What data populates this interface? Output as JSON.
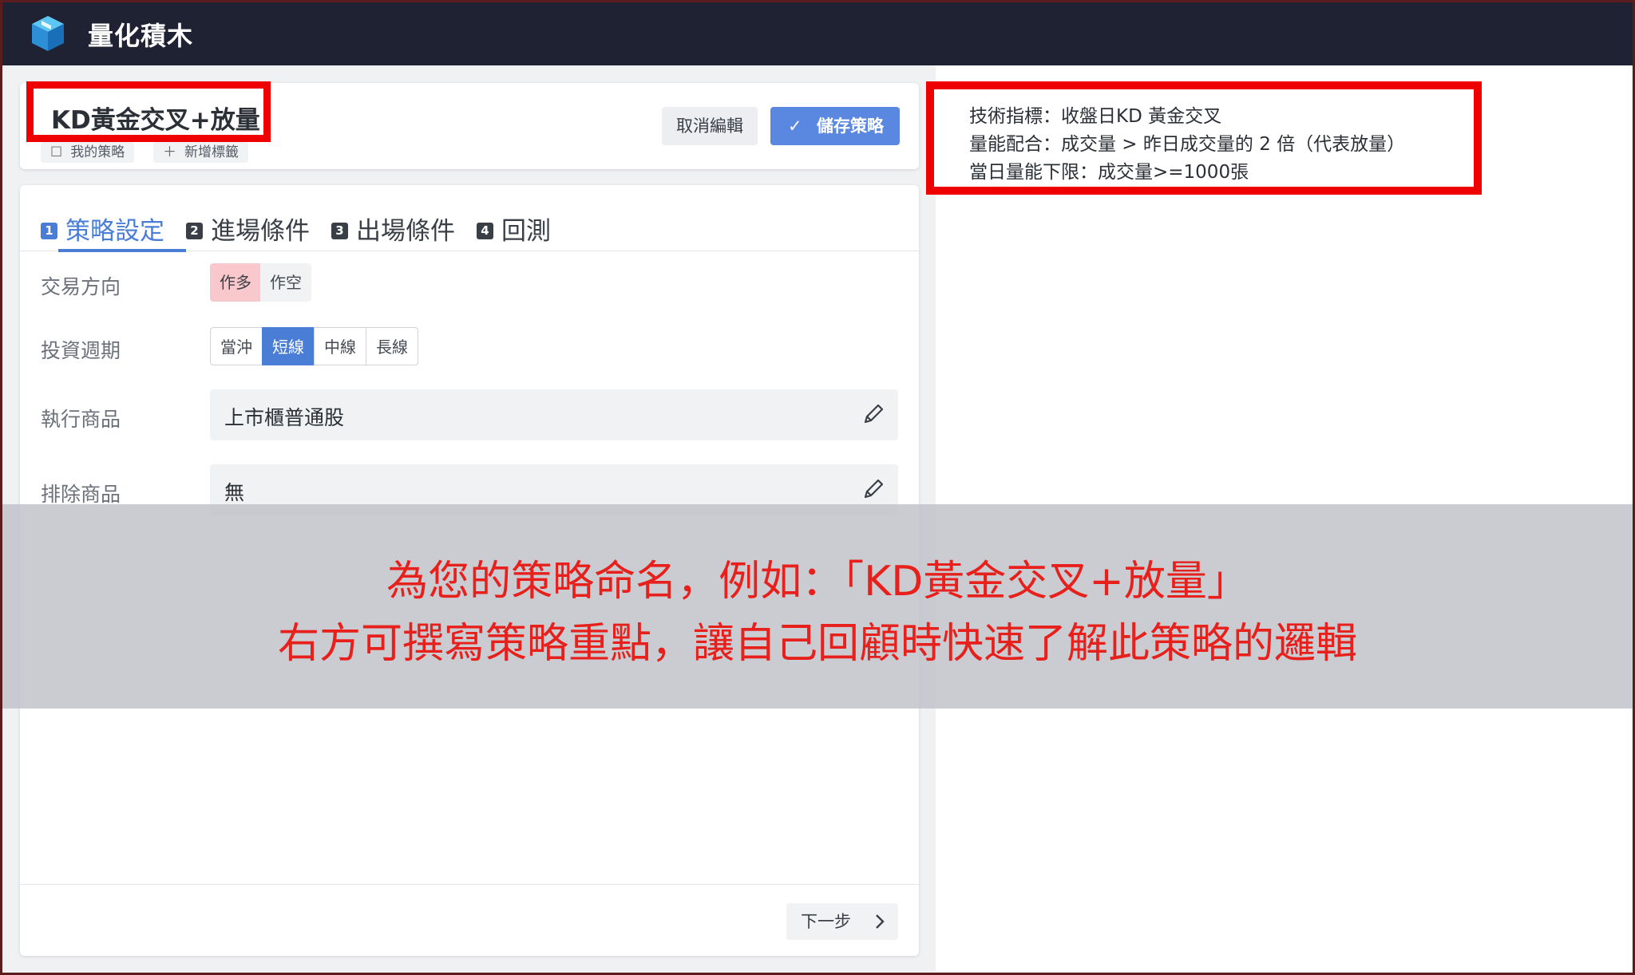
{
  "app": {
    "title": "量化積木",
    "logo_icon": "cube-logo-icon"
  },
  "strategy": {
    "name": "KD黃金交叉+放量",
    "tags": {
      "mine": "我的策略",
      "add": "新增標籤"
    }
  },
  "actions": {
    "cancel": "取消編輯",
    "save": "儲存策略",
    "next": "下一步"
  },
  "tabs": [
    {
      "num": "1",
      "label": "策略設定",
      "active": true
    },
    {
      "num": "2",
      "label": "進場條件",
      "active": false
    },
    {
      "num": "3",
      "label": "出場條件",
      "active": false
    },
    {
      "num": "4",
      "label": "回測",
      "active": false
    }
  ],
  "form": {
    "direction": {
      "label": "交易方向",
      "options": [
        "作多",
        "作空"
      ],
      "selected": "作多"
    },
    "period": {
      "label": "投資週期",
      "options": [
        "當沖",
        "短線",
        "中線",
        "長線"
      ],
      "selected": "短線"
    },
    "product": {
      "label": "執行商品",
      "value": "上市櫃普通股"
    },
    "exclude": {
      "label": "排除商品",
      "value": "無"
    }
  },
  "notes": [
    "技術指標：收盤日KD 黃金交叉",
    "量能配合：成交量 > 昨日成交量的 2 倍（代表放量）",
    "當日量能下限：成交量>=1000張"
  ],
  "overlay": {
    "line1": "為您的策略命名，例如：「KD黃金交叉+放量」",
    "line2": "右方可撰寫策略重點，讓自己回顧時快速了解此策略的邏輯"
  },
  "colors": {
    "accent": "#4a7dd6",
    "highlight_red": "#ee0000",
    "overlay_text": "#e8201c",
    "topbar": "#1f2233"
  }
}
